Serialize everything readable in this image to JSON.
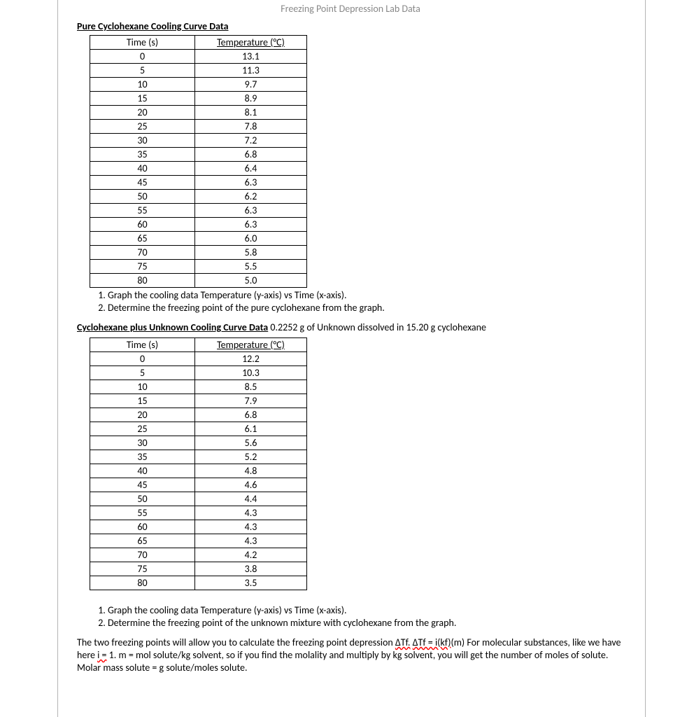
{
  "title_grey": "Freezing Point Depression Lab Data",
  "section1_title": "Pure Cyclohexane Cooling Curve Data",
  "col_time": "Time (s)",
  "col_temp": "Temperature (°C)",
  "table1": {
    "r0": {
      "t": "0",
      "v": "13.1"
    },
    "r1": {
      "t": "5",
      "v": "11.3"
    },
    "r2": {
      "t": "10",
      "v": "9.7"
    },
    "r3": {
      "t": "15",
      "v": "8.9"
    },
    "r4": {
      "t": "20",
      "v": "8.1"
    },
    "r5": {
      "t": "25",
      "v": "7.8"
    },
    "r6": {
      "t": "30",
      "v": "7.2"
    },
    "r7": {
      "t": "35",
      "v": "6.8"
    },
    "r8": {
      "t": "40",
      "v": "6.4"
    },
    "r9": {
      "t": "45",
      "v": "6.3"
    },
    "r10": {
      "t": "50",
      "v": "6.2"
    },
    "r11": {
      "t": "55",
      "v": "6.3"
    },
    "r12": {
      "t": "60",
      "v": "6.3"
    },
    "r13": {
      "t": "65",
      "v": "6.0"
    },
    "r14": {
      "t": "70",
      "v": "5.8"
    },
    "r15": {
      "t": "75",
      "v": "5.5"
    },
    "r16": {
      "t": "80",
      "v": "5.0"
    }
  },
  "task1a": "Graph the cooling data Temperature (y-axis) vs Time (x-axis).",
  "task1b": "Determine the freezing point of the pure cyclohexane from the graph.",
  "section2_lead": "Cyclohexane plus Unknown Cooling Curve Data",
  "section2_rest": " 0.2252 g of Unknown dissolved in 15.20 g cyclohexane",
  "table2": {
    "r0": {
      "t": "0",
      "v": "12.2"
    },
    "r1": {
      "t": "5",
      "v": "10.3"
    },
    "r2": {
      "t": "10",
      "v": "8.5"
    },
    "r3": {
      "t": "15",
      "v": "7.9"
    },
    "r4": {
      "t": "20",
      "v": "6.8"
    },
    "r5": {
      "t": "25",
      "v": "6.1"
    },
    "r6": {
      "t": "30",
      "v": "5.6"
    },
    "r7": {
      "t": "35",
      "v": "5.2"
    },
    "r8": {
      "t": "40",
      "v": "4.8"
    },
    "r9": {
      "t": "45",
      "v": "4.6"
    },
    "r10": {
      "t": "50",
      "v": "4.4"
    },
    "r11": {
      "t": "55",
      "v": "4.3"
    },
    "r12": {
      "t": "60",
      "v": "4.3"
    },
    "r13": {
      "t": "65",
      "v": "4.3"
    },
    "r14": {
      "t": "70",
      "v": "4.2"
    },
    "r15": {
      "t": "75",
      "v": "3.8"
    },
    "r16": {
      "t": "80",
      "v": "3.5"
    }
  },
  "task2a": "Graph the cooling data Temperature (y-axis) vs Time (x-axis).",
  "task2b": "Determine the freezing point of the unknown mixture with cyclohexane from the graph.",
  "para_pre": "The two freezing points will allow you to calculate the freezing point depression ",
  "para_sq1": "ΔTf.",
  "para_mid1": " ",
  "para_sq2": "ΔTf = i(kf)",
  "para_mid2": "(m)  For molecular substances, like we have here ",
  "para_sq3": "i =",
  "para_post": " 1.  m = mol solute/kg solvent, so if you find the molality and multiply by kg solvent, you will get the number of moles of solute.  Molar mass solute = g solute/moles solute."
}
